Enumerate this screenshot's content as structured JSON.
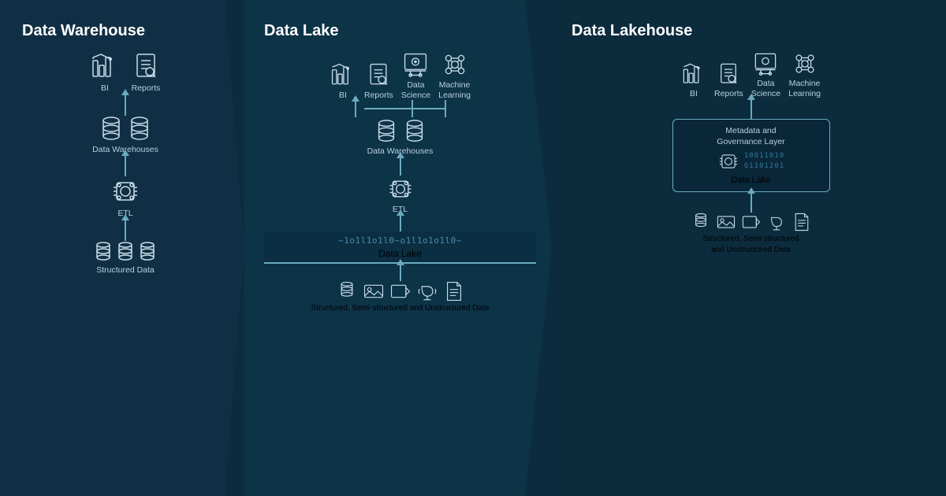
{
  "panels": [
    {
      "id": "warehouse",
      "title": "Data Warehouse",
      "top_icons": [
        {
          "label": "BI",
          "icon": "bi"
        },
        {
          "label": "Reports",
          "icon": "reports"
        }
      ],
      "mid_nodes": [
        {
          "label": "Data Warehouses",
          "icon": "db2"
        },
        {
          "label": "ETL",
          "icon": "etl"
        },
        {
          "label": "Structured Data",
          "icon": "db3"
        }
      ]
    },
    {
      "id": "lake",
      "title": "Data Lake",
      "top_icons": [
        {
          "label": "BI",
          "icon": "bi"
        },
        {
          "label": "Reports",
          "icon": "reports"
        },
        {
          "label": "Data\nScience",
          "icon": "datascience"
        },
        {
          "label": "Machine\nLearning",
          "icon": "ml"
        }
      ],
      "mid_nodes": [
        {
          "label": "Data Warehouses",
          "icon": "db2"
        },
        {
          "label": "ETL",
          "icon": "etl"
        },
        {
          "label": "Data Lake",
          "icon": "datalake"
        }
      ],
      "bottom_label": "Structured, Semi-structured and Unstructured Data",
      "bottom_icons": [
        "db",
        "image",
        "video",
        "audio",
        "doc"
      ]
    },
    {
      "id": "lakehouse",
      "title": "Data Lakehouse",
      "top_icons": [
        {
          "label": "BI",
          "icon": "bi"
        },
        {
          "label": "Reports",
          "icon": "reports"
        },
        {
          "label": "Data\nScience",
          "icon": "datascience"
        },
        {
          "label": "Machine\nLearning",
          "icon": "ml"
        }
      ],
      "gov_label": "Metadata and\nGovernance Layer",
      "datalake_label": "Data Lake",
      "binary_text": "1001101061101",
      "bottom_label": "Structured, Semi-structured\nand Unstructured Data",
      "bottom_icons": [
        "db",
        "image",
        "video",
        "audio",
        "doc"
      ]
    }
  ]
}
